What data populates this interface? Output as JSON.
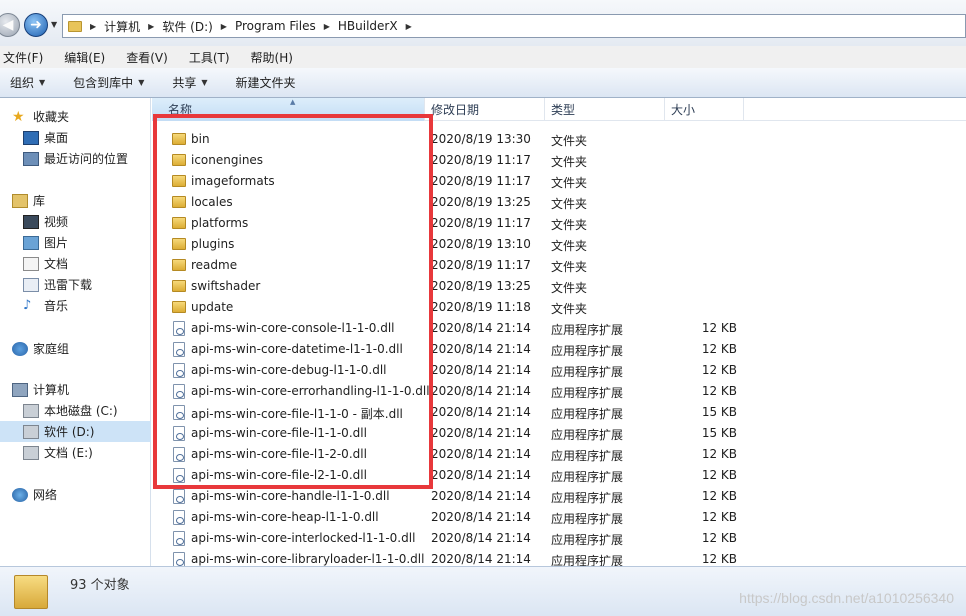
{
  "address": {
    "crumbs": [
      "计算机",
      "软件 (D:)",
      "Program Files",
      "HBuilderX"
    ]
  },
  "menu": [
    "文件(F)",
    "编辑(E)",
    "查看(V)",
    "工具(T)",
    "帮助(H)"
  ],
  "commands": [
    {
      "label": "组织",
      "dropdown": true
    },
    {
      "label": "包含到库中",
      "dropdown": true
    },
    {
      "label": "共享",
      "dropdown": true
    },
    {
      "label": "新建文件夹",
      "dropdown": false
    }
  ],
  "nav": {
    "favorites": {
      "label": "收藏夹",
      "items": [
        "桌面",
        "最近访问的位置"
      ]
    },
    "libraries": {
      "label": "库",
      "items": [
        "视频",
        "图片",
        "文档",
        "迅雷下载",
        "音乐"
      ]
    },
    "homegroup": "家庭组",
    "computer": {
      "label": "计算机",
      "items": [
        "本地磁盘 (C:)",
        "软件 (D:)",
        "文档 (E:)"
      ]
    },
    "network": "网络"
  },
  "columns": {
    "name": "名称",
    "date": "修改日期",
    "type": "类型",
    "size": "大小"
  },
  "files": [
    {
      "name": "bin",
      "date": "2020/8/19 13:30",
      "type": "文件夹",
      "size": "",
      "kind": "folder"
    },
    {
      "name": "iconengines",
      "date": "2020/8/19 11:17",
      "type": "文件夹",
      "size": "",
      "kind": "folder"
    },
    {
      "name": "imageformats",
      "date": "2020/8/19 11:17",
      "type": "文件夹",
      "size": "",
      "kind": "folder"
    },
    {
      "name": "locales",
      "date": "2020/8/19 13:25",
      "type": "文件夹",
      "size": "",
      "kind": "folder"
    },
    {
      "name": "platforms",
      "date": "2020/8/19 11:17",
      "type": "文件夹",
      "size": "",
      "kind": "folder"
    },
    {
      "name": "plugins",
      "date": "2020/8/19 13:10",
      "type": "文件夹",
      "size": "",
      "kind": "folder"
    },
    {
      "name": "readme",
      "date": "2020/8/19 11:17",
      "type": "文件夹",
      "size": "",
      "kind": "folder"
    },
    {
      "name": "swiftshader",
      "date": "2020/8/19 13:25",
      "type": "文件夹",
      "size": "",
      "kind": "folder"
    },
    {
      "name": "update",
      "date": "2020/8/19 11:18",
      "type": "文件夹",
      "size": "",
      "kind": "folder"
    },
    {
      "name": "api-ms-win-core-console-l1-1-0.dll",
      "date": "2020/8/14 21:14",
      "type": "应用程序扩展",
      "size": "12 KB",
      "kind": "dll"
    },
    {
      "name": "api-ms-win-core-datetime-l1-1-0.dll",
      "date": "2020/8/14 21:14",
      "type": "应用程序扩展",
      "size": "12 KB",
      "kind": "dll"
    },
    {
      "name": "api-ms-win-core-debug-l1-1-0.dll",
      "date": "2020/8/14 21:14",
      "type": "应用程序扩展",
      "size": "12 KB",
      "kind": "dll"
    },
    {
      "name": "api-ms-win-core-errorhandling-l1-1-0.dll",
      "date": "2020/8/14 21:14",
      "type": "应用程序扩展",
      "size": "12 KB",
      "kind": "dll"
    },
    {
      "name": "api-ms-win-core-file-l1-1-0 - 副本.dll",
      "date": "2020/8/14 21:14",
      "type": "应用程序扩展",
      "size": "15 KB",
      "kind": "dll"
    },
    {
      "name": "api-ms-win-core-file-l1-1-0.dll",
      "date": "2020/8/14 21:14",
      "type": "应用程序扩展",
      "size": "15 KB",
      "kind": "dll"
    },
    {
      "name": "api-ms-win-core-file-l1-2-0.dll",
      "date": "2020/8/14 21:14",
      "type": "应用程序扩展",
      "size": "12 KB",
      "kind": "dll"
    },
    {
      "name": "api-ms-win-core-file-l2-1-0.dll",
      "date": "2020/8/14 21:14",
      "type": "应用程序扩展",
      "size": "12 KB",
      "kind": "dll"
    },
    {
      "name": "api-ms-win-core-handle-l1-1-0.dll",
      "date": "2020/8/14 21:14",
      "type": "应用程序扩展",
      "size": "12 KB",
      "kind": "dll"
    },
    {
      "name": "api-ms-win-core-heap-l1-1-0.dll",
      "date": "2020/8/14 21:14",
      "type": "应用程序扩展",
      "size": "12 KB",
      "kind": "dll"
    },
    {
      "name": "api-ms-win-core-interlocked-l1-1-0.dll",
      "date": "2020/8/14 21:14",
      "type": "应用程序扩展",
      "size": "12 KB",
      "kind": "dll"
    },
    {
      "name": "api-ms-win-core-libraryloader-l1-1-0.dll",
      "date": "2020/8/14 21:14",
      "type": "应用程序扩展",
      "size": "12 KB",
      "kind": "dll"
    }
  ],
  "status": {
    "count_text": "93 个对象"
  },
  "watermark": "https://blog.csdn.net/a1010256340",
  "colors": {
    "highlight": "#e8383b",
    "selected": "#cde3f7"
  }
}
